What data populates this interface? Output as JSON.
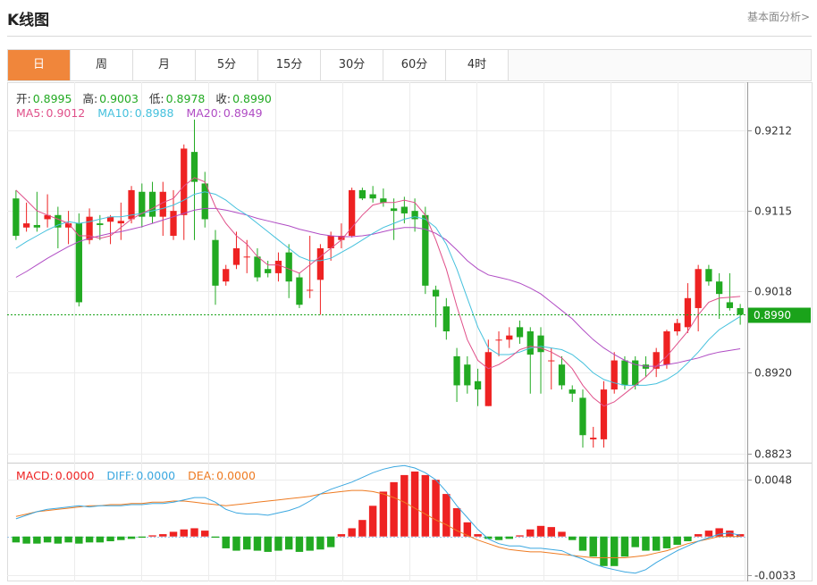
{
  "header": {
    "title": "K线图",
    "link": "基本面分析>"
  },
  "tabs": [
    "日",
    "周",
    "月",
    "5分",
    "15分",
    "30分",
    "60分",
    "4时"
  ],
  "active_tab": 0,
  "ohlc_info": {
    "open_label": "开:",
    "open": "0.8995",
    "high_label": "高:",
    "high": "0.9003",
    "low_label": "低:",
    "low": "0.8978",
    "close_label": "收:",
    "close": "0.8990"
  },
  "ma_info": {
    "ma5_label": "MA5:",
    "ma5": "0.9012",
    "ma10_label": "MA10:",
    "ma10": "0.8988",
    "ma20_label": "MA20:",
    "ma20": "0.8949"
  },
  "macd_info": {
    "macd_label": "MACD:",
    "macd": "0.0000",
    "diff_label": "DIFF:",
    "diff": "0.0000",
    "dea_label": "DEA:",
    "dea": "0.0000"
  },
  "colors": {
    "up": "#ee2222",
    "down": "#22aa22",
    "ma5": "#e0508a",
    "ma10": "#45c1dd",
    "ma20": "#b04cc4",
    "diff": "#3aa7e0",
    "dea": "#ee7b22",
    "grid": "#ececec",
    "price_tag": "#1aa31a"
  },
  "chart_data": {
    "type": "candlestick",
    "y_ticks": [
      "0.9212",
      "0.9115",
      "0.9018",
      "0.8920",
      "0.8823"
    ],
    "ylim": [
      0.8813,
      0.927
    ],
    "last_price": "0.8990",
    "candles": [
      [
        0.913,
        0.9085,
        0.914,
        0.908
      ],
      [
        0.9095,
        0.91,
        0.9125,
        0.909
      ],
      [
        0.9098,
        0.9095,
        0.9138,
        0.909
      ],
      [
        0.9105,
        0.911,
        0.9135,
        0.9095
      ],
      [
        0.911,
        0.9095,
        0.912,
        0.907
      ],
      [
        0.9095,
        0.91,
        0.9115,
        0.9075
      ],
      [
        0.91,
        0.9005,
        0.9112,
        0.9
      ],
      [
        0.908,
        0.9108,
        0.9118,
        0.9075
      ],
      [
        0.91,
        0.9098,
        0.911,
        0.908
      ],
      [
        0.9102,
        0.9108,
        0.911,
        0.9075
      ],
      [
        0.91,
        0.9103,
        0.9125,
        0.908
      ],
      [
        0.9105,
        0.914,
        0.9145,
        0.91
      ],
      [
        0.9138,
        0.9108,
        0.9148,
        0.9095
      ],
      [
        0.9138,
        0.9108,
        0.915,
        0.91
      ],
      [
        0.9108,
        0.9138,
        0.915,
        0.9085
      ],
      [
        0.9085,
        0.9115,
        0.914,
        0.908
      ],
      [
        0.911,
        0.919,
        0.9195,
        0.908
      ],
      [
        0.9186,
        0.915,
        0.9225,
        0.908
      ],
      [
        0.9148,
        0.9105,
        0.9162,
        0.9095
      ],
      [
        0.908,
        0.9025,
        0.9092,
        0.9002
      ],
      [
        0.903,
        0.9045,
        0.905,
        0.9025
      ],
      [
        0.905,
        0.907,
        0.909,
        0.9045
      ],
      [
        0.906,
        0.906,
        0.908,
        0.904
      ],
      [
        0.906,
        0.9035,
        0.907,
        0.903
      ],
      [
        0.9045,
        0.904,
        0.9055,
        0.9035
      ],
      [
        0.904,
        0.9055,
        0.9065,
        0.903
      ],
      [
        0.9065,
        0.903,
        0.9075,
        0.901
      ],
      [
        0.9035,
        0.9002,
        0.904,
        0.8998
      ],
      [
        0.902,
        0.902,
        0.9085,
        0.901
      ],
      [
        0.9032,
        0.907,
        0.9075,
        0.899
      ],
      [
        0.907,
        0.9085,
        0.909,
        0.9055
      ],
      [
        0.908,
        0.9085,
        0.91,
        0.907
      ],
      [
        0.9085,
        0.914,
        0.9143,
        0.9083
      ],
      [
        0.914,
        0.913,
        0.9143,
        0.9128
      ],
      [
        0.9135,
        0.913,
        0.9145,
        0.9125
      ],
      [
        0.913,
        0.9125,
        0.9142,
        0.912
      ],
      [
        0.9118,
        0.9115,
        0.913,
        0.908
      ],
      [
        0.912,
        0.9112,
        0.9132,
        0.91
      ],
      [
        0.9115,
        0.9105,
        0.913,
        0.909
      ],
      [
        0.911,
        0.9025,
        0.912,
        0.9015
      ],
      [
        0.902,
        0.9012,
        0.9025,
        0.8975
      ],
      [
        0.9,
        0.897,
        0.901,
        0.896
      ],
      [
        0.894,
        0.8905,
        0.895,
        0.8885
      ],
      [
        0.893,
        0.8905,
        0.894,
        0.8895
      ],
      [
        0.891,
        0.89,
        0.8925,
        0.888
      ],
      [
        0.888,
        0.8945,
        0.896,
        0.888
      ],
      [
        0.896,
        0.896,
        0.897,
        0.894
      ],
      [
        0.896,
        0.8965,
        0.8975,
        0.895
      ],
      [
        0.8975,
        0.8963,
        0.8983,
        0.8955
      ],
      [
        0.897,
        0.8942,
        0.8975,
        0.8895
      ],
      [
        0.8965,
        0.8945,
        0.8975,
        0.8895
      ],
      [
        0.8935,
        0.8935,
        0.895,
        0.89
      ],
      [
        0.893,
        0.8905,
        0.894,
        0.89
      ],
      [
        0.89,
        0.8895,
        0.8905,
        0.8885
      ],
      [
        0.889,
        0.8845,
        0.89,
        0.883
      ],
      [
        0.884,
        0.8842,
        0.8855,
        0.883
      ],
      [
        0.884,
        0.89,
        0.891,
        0.883
      ],
      [
        0.89,
        0.8935,
        0.8945,
        0.8895
      ],
      [
        0.8935,
        0.8905,
        0.894,
        0.89
      ],
      [
        0.8935,
        0.8905,
        0.894,
        0.89
      ],
      [
        0.893,
        0.8925,
        0.894,
        0.8915
      ],
      [
        0.8925,
        0.8945,
        0.895,
        0.8915
      ],
      [
        0.893,
        0.897,
        0.8972,
        0.8925
      ],
      [
        0.897,
        0.898,
        0.8985,
        0.8965
      ],
      [
        0.8975,
        0.901,
        0.9028,
        0.8968
      ],
      [
        0.8998,
        0.9045,
        0.905,
        0.897
      ],
      [
        0.9045,
        0.903,
        0.905,
        0.9025
      ],
      [
        0.903,
        0.9015,
        0.904,
        0.8985
      ],
      [
        0.9005,
        0.8998,
        0.904,
        0.8995
      ],
      [
        0.8998,
        0.899,
        0.9003,
        0.8978
      ]
    ],
    "ma5": [
      0.914,
      0.9128,
      0.9115,
      0.911,
      0.9105,
      0.91,
      0.9085,
      0.9085,
      0.9082,
      0.9085,
      0.9095,
      0.9105,
      0.9112,
      0.9118,
      0.9125,
      0.913,
      0.9145,
      0.9155,
      0.915,
      0.912,
      0.91,
      0.9085,
      0.9075,
      0.906,
      0.905,
      0.905,
      0.9045,
      0.904,
      0.905,
      0.906,
      0.907,
      0.908,
      0.9095,
      0.911,
      0.9122,
      0.9125,
      0.9125,
      0.9128,
      0.9125,
      0.911,
      0.908,
      0.9045,
      0.9,
      0.896,
      0.8935,
      0.8925,
      0.893,
      0.8938,
      0.8948,
      0.8952,
      0.895,
      0.8945,
      0.8938,
      0.8925,
      0.8905,
      0.889,
      0.888,
      0.8885,
      0.8895,
      0.8905,
      0.8915,
      0.8928,
      0.894,
      0.8955,
      0.897,
      0.899,
      0.9005,
      0.901,
      0.9011,
      0.9012
    ],
    "ma10": [
      0.907,
      0.9078,
      0.9085,
      0.9092,
      0.9098,
      0.9102,
      0.91,
      0.9102,
      0.9105,
      0.9108,
      0.9108,
      0.911,
      0.9112,
      0.9115,
      0.9118,
      0.9122,
      0.9128,
      0.9135,
      0.9138,
      0.9135,
      0.9128,
      0.9118,
      0.911,
      0.91,
      0.909,
      0.908,
      0.907,
      0.906,
      0.9055,
      0.9055,
      0.9058,
      0.9065,
      0.9072,
      0.908,
      0.9088,
      0.9095,
      0.91,
      0.9105,
      0.9108,
      0.9105,
      0.9095,
      0.9075,
      0.9045,
      0.901,
      0.8975,
      0.895,
      0.8942,
      0.8942,
      0.8945,
      0.895,
      0.8952,
      0.895,
      0.8948,
      0.8942,
      0.8932,
      0.892,
      0.8912,
      0.8908,
      0.8905,
      0.8905,
      0.8905,
      0.8907,
      0.8912,
      0.892,
      0.8932,
      0.8945,
      0.896,
      0.8972,
      0.898,
      0.8988
    ],
    "ma20": [
      0.9035,
      0.9042,
      0.905,
      0.9058,
      0.9065,
      0.9072,
      0.9078,
      0.9082,
      0.9085,
      0.9088,
      0.909,
      0.9093,
      0.9096,
      0.91,
      0.9104,
      0.9108,
      0.9112,
      0.9116,
      0.9118,
      0.9118,
      0.9116,
      0.9113,
      0.911,
      0.9106,
      0.9103,
      0.91,
      0.9097,
      0.9093,
      0.909,
      0.9087,
      0.9085,
      0.9084,
      0.9084,
      0.9085,
      0.9087,
      0.909,
      0.9093,
      0.9095,
      0.9095,
      0.9093,
      0.9088,
      0.908,
      0.9068,
      0.9055,
      0.9045,
      0.9038,
      0.9035,
      0.9032,
      0.9028,
      0.9022,
      0.9015,
      0.9005,
      0.8995,
      0.8985,
      0.8972,
      0.896,
      0.895,
      0.8942,
      0.8935,
      0.893,
      0.8928,
      0.8928,
      0.893,
      0.8932,
      0.8935,
      0.8938,
      0.8942,
      0.8945,
      0.8947,
      0.8949
    ],
    "macd": {
      "y_ticks": [
        "0.0048",
        "-0.0033"
      ],
      "ylim": [
        -0.0038,
        0.0061
      ],
      "hist": [
        -0.0005,
        -0.0006,
        -0.0006,
        -0.0005,
        -0.0006,
        -0.0005,
        -0.0006,
        -0.0005,
        -0.0005,
        -0.0004,
        -0.0003,
        -0.0002,
        -0.0001,
        0.0001,
        0.0002,
        0.0004,
        0.0006,
        0.0007,
        0.0005,
        -0.0001,
        -0.001,
        -0.0012,
        -0.0011,
        -0.0012,
        -0.0013,
        -0.0012,
        -0.0011,
        -0.0013,
        -0.0012,
        -0.0011,
        -0.0009,
        0.0002,
        0.0007,
        0.0014,
        0.0026,
        0.0038,
        0.0046,
        0.0052,
        0.0055,
        0.0052,
        0.0048,
        0.0036,
        0.0024,
        0.0012,
        0.0002,
        -0.0002,
        -0.0003,
        -0.0002,
        0.0001,
        0.0006,
        0.0009,
        0.0008,
        0.0004,
        -0.0003,
        -0.0012,
        -0.0017,
        -0.0025,
        -0.0025,
        -0.0017,
        -0.0009,
        -0.0012,
        -0.0012,
        -0.001,
        -0.0007,
        -0.0004,
        0.0002,
        0.0005,
        0.0007,
        0.0005,
        0.0002
      ],
      "diff": [
        0.0015,
        0.0018,
        0.0021,
        0.0023,
        0.0024,
        0.0025,
        0.0026,
        0.0025,
        0.0026,
        0.0026,
        0.0026,
        0.0027,
        0.0027,
        0.0028,
        0.0028,
        0.0029,
        0.0031,
        0.0033,
        0.0033,
        0.0029,
        0.0023,
        0.002,
        0.0019,
        0.0019,
        0.0018,
        0.002,
        0.0022,
        0.0025,
        0.003,
        0.0036,
        0.004,
        0.0043,
        0.0046,
        0.005,
        0.0054,
        0.0057,
        0.0059,
        0.006,
        0.0058,
        0.0054,
        0.0048,
        0.0038,
        0.0026,
        0.0016,
        0.0006,
        -0.0002,
        -0.0006,
        -0.0008,
        -0.0008,
        -0.001,
        -0.001,
        -0.0011,
        -0.0012,
        -0.0016,
        -0.0019,
        -0.0023,
        -0.0026,
        -0.0028,
        -0.003,
        -0.0031,
        -0.0028,
        -0.0022,
        -0.0017,
        -0.0012,
        -0.0008,
        -0.0004,
        -0.0001,
        0.0002,
        0.0003,
        0.0001
      ],
      "dea": [
        0.0017,
        0.0019,
        0.0021,
        0.0022,
        0.0023,
        0.0024,
        0.0025,
        0.0026,
        0.0026,
        0.0027,
        0.0027,
        0.0028,
        0.0028,
        0.0029,
        0.0029,
        0.003,
        0.003,
        0.0029,
        0.0028,
        0.0027,
        0.0026,
        0.0027,
        0.0028,
        0.0029,
        0.003,
        0.0031,
        0.0032,
        0.0033,
        0.0034,
        0.0036,
        0.0037,
        0.0038,
        0.0039,
        0.0039,
        0.0038,
        0.0036,
        0.0033,
        0.0029,
        0.0024,
        0.0019,
        0.0014,
        0.001,
        0.0005,
        0.0001,
        -0.0003,
        -0.0006,
        -0.0009,
        -0.0011,
        -0.0012,
        -0.0013,
        -0.0013,
        -0.0014,
        -0.0015,
        -0.0016,
        -0.0017,
        -0.0018,
        -0.0018,
        -0.0018,
        -0.0018,
        -0.0017,
        -0.0016,
        -0.0014,
        -0.0012,
        -0.0009,
        -0.0006,
        -0.0004,
        -0.0002,
        0.0,
        0.0,
        0.0
      ]
    }
  }
}
